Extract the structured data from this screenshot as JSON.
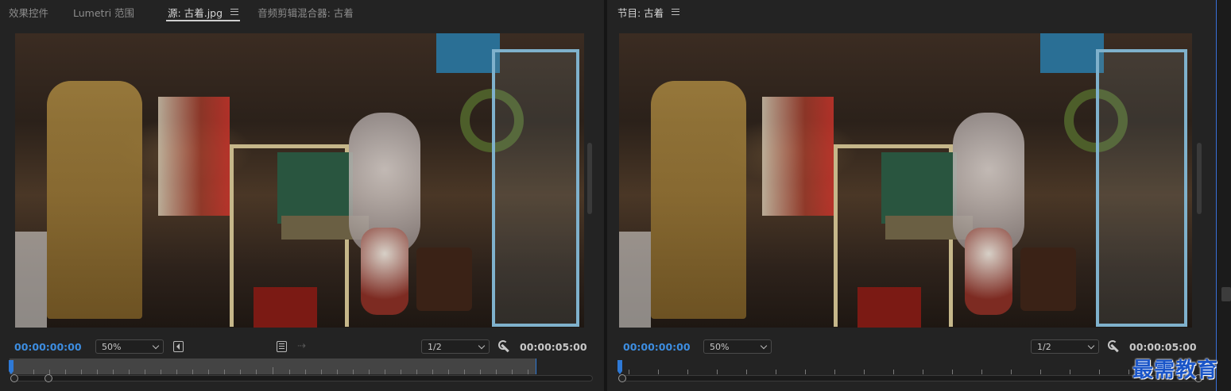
{
  "source_panel": {
    "tabs": [
      {
        "label": "效果控件",
        "active": false
      },
      {
        "label": "Lumetri 范围",
        "active": false
      },
      {
        "label": "源: 古着.jpg",
        "active": true
      },
      {
        "label": "音频剪辑混合器: 古着",
        "active": false
      }
    ],
    "timecode_current": "00:00:00:00",
    "zoom": "50%",
    "resolution": "1/2",
    "timecode_duration": "00:00:05:00"
  },
  "program_panel": {
    "tab": {
      "label": "节目: 古着",
      "active": true
    },
    "timecode_current": "00:00:00:00",
    "zoom": "50%",
    "resolution": "1/2",
    "timecode_duration": "00:00:05:00"
  },
  "icons": {
    "panel_menu": "menu-icon",
    "insert": "insert-icon",
    "export_frame": "film-icon",
    "drag_video": "drag-icon",
    "settings": "wrench-icon"
  },
  "colors": {
    "timecode_active": "#3d8de0",
    "playhead": "#2e79d6",
    "panel_bg": "#232323"
  },
  "watermark": "最需教育"
}
